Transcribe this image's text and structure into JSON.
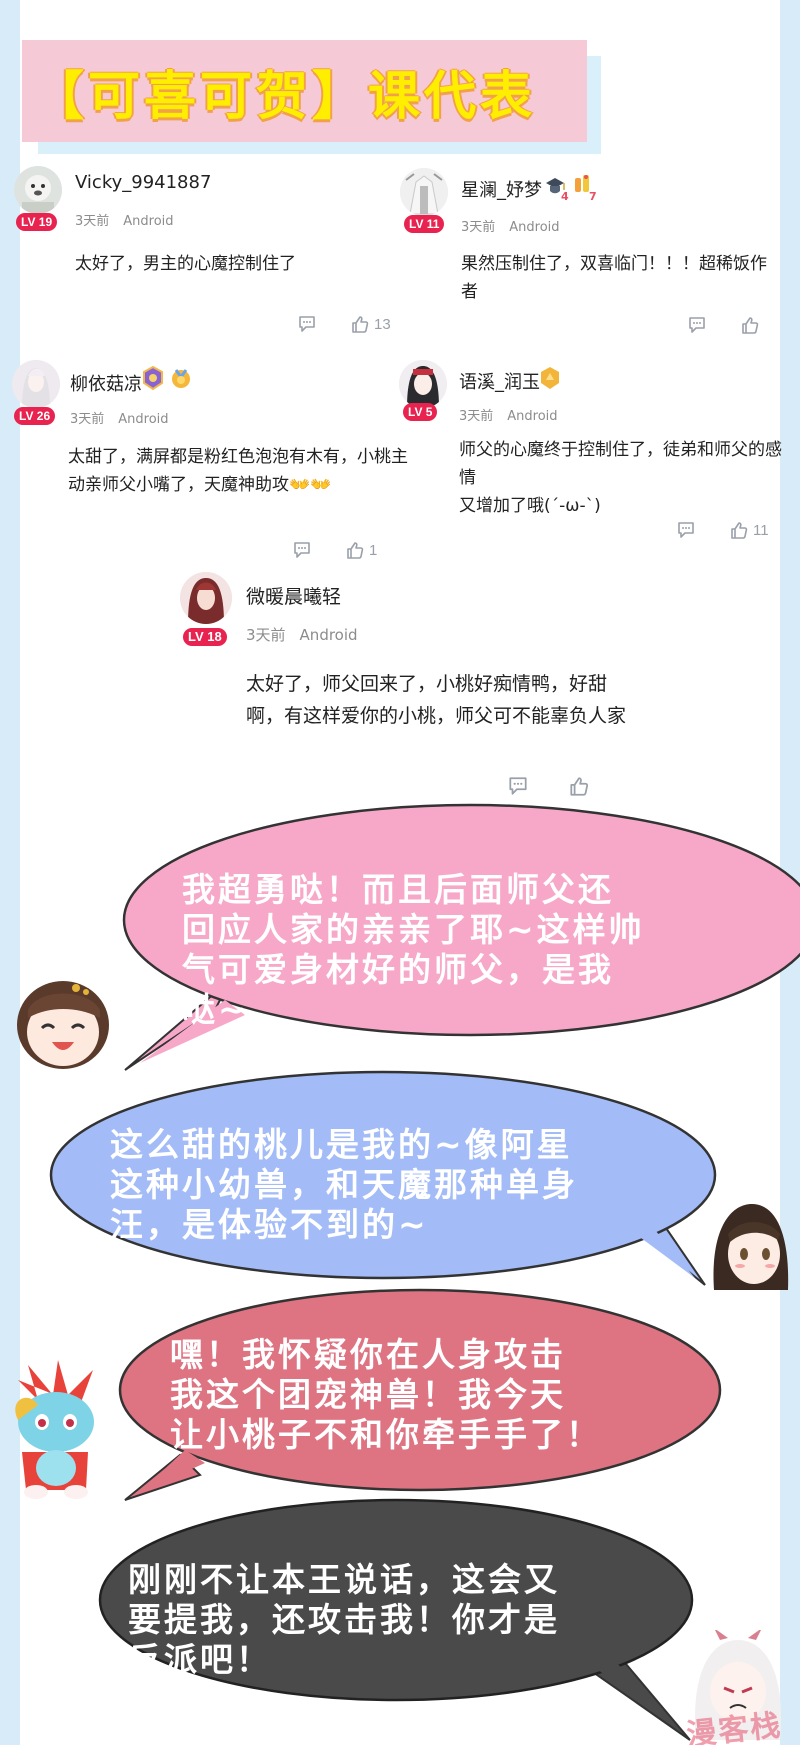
{
  "header": {
    "title": "【可喜可贺】课代表"
  },
  "comments": [
    {
      "username": "Vicky_9941887",
      "level": "LV 19",
      "time": "3天前",
      "platform": "Android",
      "text": "太好了，男主的心魔控制住了",
      "likes": "13"
    },
    {
      "username": "星澜_妤梦",
      "level": "LV 11",
      "time": "3天前",
      "platform": "Android",
      "text": "果然压制住了，双喜临门！！！超稀饭作者",
      "likes": "",
      "medals": [
        "4",
        "7"
      ]
    },
    {
      "username": "柳依菇凉",
      "level": "LV 26",
      "time": "3天前",
      "platform": "Android",
      "text_lines": [
        "太甜了，满屏都是粉红色泡泡有木有，小桃主",
        "动亲师父小嘴了，天魔神助攻👐👐"
      ],
      "likes": "1"
    },
    {
      "username": "语溪_润玉",
      "level": "LV 5",
      "time": "3天前",
      "platform": "Android",
      "text_lines": [
        "师父的心魔终于控制住了，徒弟和师父的感情",
        "又增加了哦(´-ω-`)"
      ],
      "likes": "11"
    },
    {
      "username": "微暖晨曦轻",
      "level": "LV 18",
      "time": "3天前",
      "platform": "Android",
      "text_lines": [
        "太好了，师父回来了，小桃好痴情鸭，好甜",
        "啊，有这样爱你的小桃，师父可不能辜负人家"
      ],
      "likes": ""
    }
  ],
  "bubbles": [
    {
      "lines": [
        "我超勇哒！而且后面师父还",
        "回应人家的亲亲了耶~这样帅",
        "气可爱身材好的师父，是我",
        "哒~"
      ],
      "fill": "#f7a8c8",
      "text_color": "#ffffff"
    },
    {
      "lines": [
        "这么甜的桃儿是我的~像阿星",
        "这种小幼兽，和天魔那种单身",
        "汪，是体验不到的~"
      ],
      "fill": "#a3bcf7",
      "text_color": "#ffffff"
    },
    {
      "lines": [
        "嘿！我怀疑你在人身攻击",
        "我这个团宠神兽！我今天",
        "让小桃子不和你牵手手了！"
      ],
      "fill": "#de7382",
      "text_color": "#ffffff"
    },
    {
      "lines": [
        "刚刚不让本王说话，这会又",
        "要提我，还攻击我！你才是",
        "反派吧！"
      ],
      "fill": "#4a4a4a",
      "text_color": "#ffffff"
    }
  ],
  "watermark": "漫客栈",
  "colors": {
    "level_badge": "#e8234f",
    "title_bg": "#f6c9d6",
    "title_text": "#ffee00",
    "edge": "#d7ecf8"
  }
}
